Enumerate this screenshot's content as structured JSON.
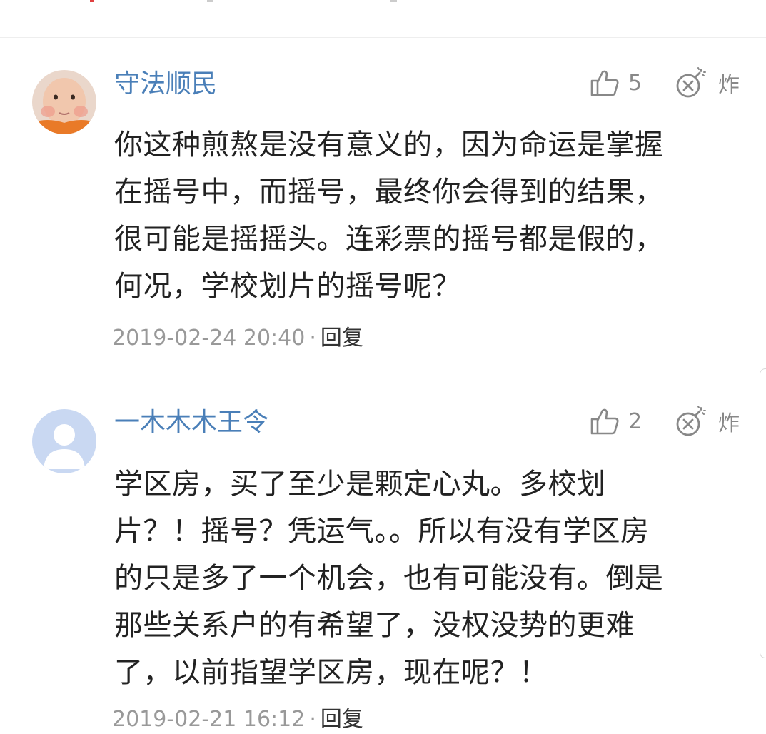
{
  "comments": [
    {
      "username": "守法顺民",
      "like_count": "5",
      "bomb_label": "炸",
      "content_lines": [
        "你这种煎熬是没有意义的，因为命运是掌握",
        "在摇号中，而摇号，最终你会得到的结果，",
        "很可能是摇摇头。连彩票的摇号都是假的，",
        "何况，学校划片的摇号呢？"
      ],
      "timestamp": "2019-02-24 20:40",
      "separator": "·",
      "reply_label": "回复",
      "avatar_icon": "child-photo-avatar"
    },
    {
      "username": "一木木木王令",
      "like_count": "2",
      "bomb_label": "炸",
      "content_lines": [
        "学区房，买了至少是颗定心丸。多校划",
        "片？！摇号？凭运气。。所以有没有学区房",
        "的只是多了一个机会，也有可能没有。倒是",
        "那些关系户的有希望了，没权没势的更难",
        "了，以前指望学区房，现在呢？！"
      ],
      "timestamp": "2019-02-21 16:12",
      "separator": "·",
      "reply_label": "回复",
      "avatar_icon": "default-user-avatar"
    }
  ],
  "colors": {
    "username": "#4a7fb8",
    "content": "#222222",
    "meta": "#999999",
    "icon": "#888888",
    "default_avatar_bg": "#c9d8f2"
  }
}
